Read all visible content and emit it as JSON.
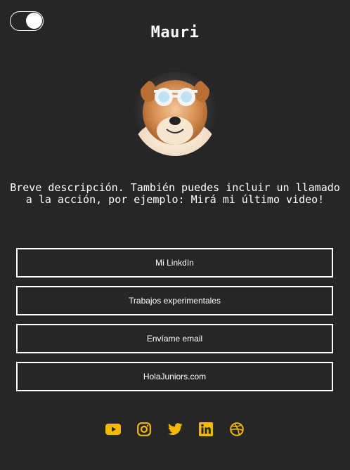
{
  "theme": {
    "background": "#262626",
    "text": "#ffffff",
    "accent": "#f5b800"
  },
  "toggle": {
    "state": "on"
  },
  "profile": {
    "name": "Mauri",
    "description": "Breve descripción. También puedes incluir un llamado a la acción, por ejemplo: Mirá mi último video!"
  },
  "links": [
    {
      "label": "Mi LinkdIn"
    },
    {
      "label": "Trabajos experimentales"
    },
    {
      "label": "Envíame email"
    },
    {
      "label": "HolaJuniors.com"
    }
  ],
  "socials": [
    {
      "icon": "youtube-icon"
    },
    {
      "icon": "instagram-icon"
    },
    {
      "icon": "twitter-icon"
    },
    {
      "icon": "linkedin-icon"
    },
    {
      "icon": "dribbble-icon"
    }
  ]
}
